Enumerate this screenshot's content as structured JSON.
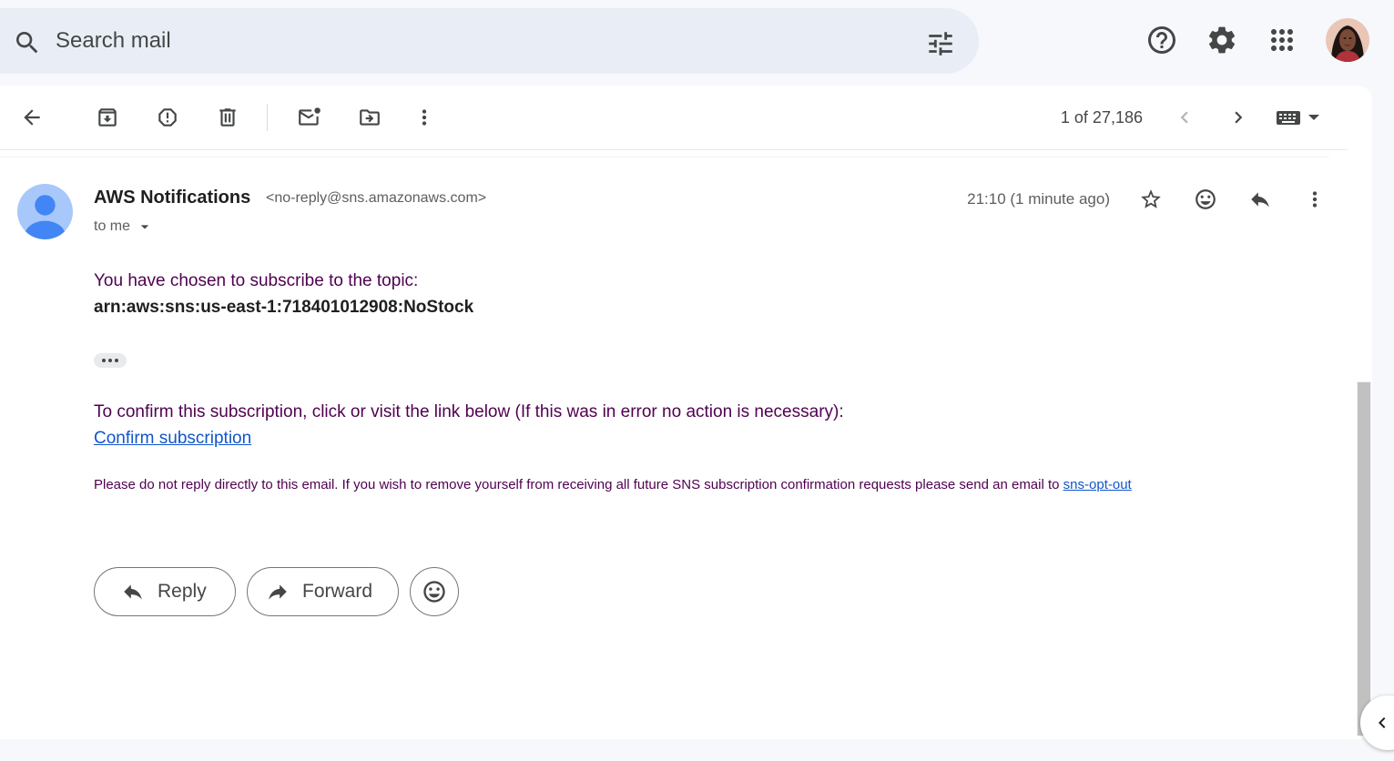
{
  "search": {
    "placeholder": "Search mail"
  },
  "colors": {
    "accent": "#1155cc",
    "body_text": "#500050",
    "sender_avatar": "#4285f4"
  },
  "toolbar": {
    "icons": [
      "back-icon",
      "archive-icon",
      "report-spam-icon",
      "delete-icon",
      "mark-unread-icon",
      "move-to-icon",
      "more-vert-icon"
    ],
    "page_count": "1 of 27,186"
  },
  "message": {
    "sender_name": "AWS Notifications",
    "sender_email": "<no-reply@sns.amazonaws.com>",
    "recipient": "to me",
    "timestamp": "21:10 (1 minute ago)",
    "body": {
      "intro": "You have chosen to subscribe to the topic:",
      "topic_arn": "arn:aws:sns:us-east-1:718401012908:NoStock",
      "confirm_text": "To confirm this subscription, click or visit the link below (If this was in error no action is necessary):",
      "confirm_link": "Confirm subscription",
      "fine_print": "Please do not reply directly to this email. If you wish to remove yourself from receiving all future SNS subscription confirmation requests please send an email to",
      "opt_out_link": "sns-opt-out"
    }
  },
  "actions": {
    "reply": "Reply",
    "forward": "Forward"
  }
}
